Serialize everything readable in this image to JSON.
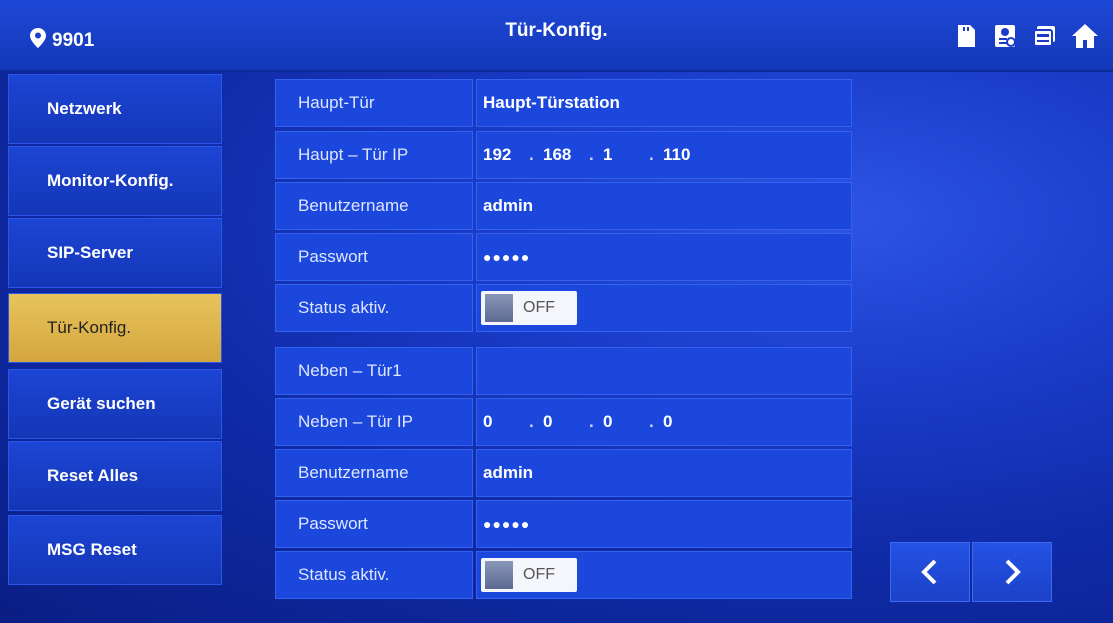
{
  "header": {
    "location": "9901",
    "title": "Tür-Konfig.",
    "icons": [
      "sd-card-icon",
      "contact-card-icon",
      "device-icon",
      "home-icon"
    ]
  },
  "sidebar": {
    "items": [
      {
        "label": "Netzwerk"
      },
      {
        "label": "Monitor-Konfig."
      },
      {
        "label": "SIP-Server"
      },
      {
        "label": "Tür-Konfig.",
        "active": true
      },
      {
        "label": "Gerät suchen"
      },
      {
        "label": "Reset Alles"
      },
      {
        "label": "MSG Reset"
      }
    ]
  },
  "main": {
    "main_door_label": "Haupt-Tür",
    "main_door_value": "Haupt-Türstation",
    "main_ip_label": "Haupt – Tür IP",
    "main_ip": [
      "192",
      "168",
      "1",
      "110"
    ],
    "main_user_label": "Benutzername",
    "main_user_value": "admin",
    "main_pass_label": "Passwort",
    "main_pass_value": "●●●●●",
    "main_status_label": "Status aktiv.",
    "main_status_value": "OFF",
    "sub_door_label": "Neben – Tür1",
    "sub_door_value": "",
    "sub_ip_label": "Neben – Tür IP",
    "sub_ip": [
      "0",
      "0",
      "0",
      "0"
    ],
    "sub_user_label": "Benutzername",
    "sub_user_value": "admin",
    "sub_pass_label": "Passwort",
    "sub_pass_value": "●●●●●",
    "sub_status_label": "Status aktiv.",
    "sub_status_value": "OFF"
  },
  "colors": {
    "background": "#1a3cc9",
    "active_tab": "#d4a63e"
  }
}
